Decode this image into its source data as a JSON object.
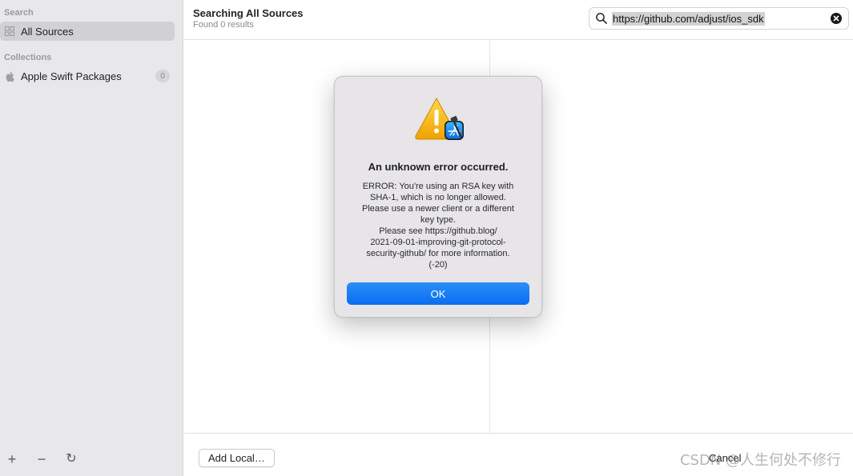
{
  "sidebar": {
    "search_label": "Search",
    "all_sources": "All Sources",
    "collections_label": "Collections",
    "collections": [
      {
        "label": "Apple Swift Packages",
        "count": "0"
      }
    ],
    "tools": {
      "add": "+",
      "remove": "−",
      "refresh": "↻"
    }
  },
  "header": {
    "title": "Searching All Sources",
    "subtitle": "Found 0 results"
  },
  "search": {
    "value": "https://github.com/adjust/ios_sdk"
  },
  "footer": {
    "add_local": "Add Local…",
    "cancel": "Cancel",
    "watermark": "CSDN @人生何处不修行"
  },
  "dialog": {
    "title": "An unknown error occurred.",
    "message_lines": [
      "ERROR: You're using an RSA key with",
      "SHA-1, which is no longer allowed.",
      "Please use a newer client or a different",
      "key type.",
      "Please see https://github.blog/",
      "2021-09-01-improving-git-protocol-",
      "security-github/ for more information.",
      "(-20)"
    ],
    "ok": "OK"
  },
  "colors": {
    "accent": "#0a6df0",
    "sidebar_bg": "#e8e7e9",
    "warning": "#f5b80f"
  }
}
